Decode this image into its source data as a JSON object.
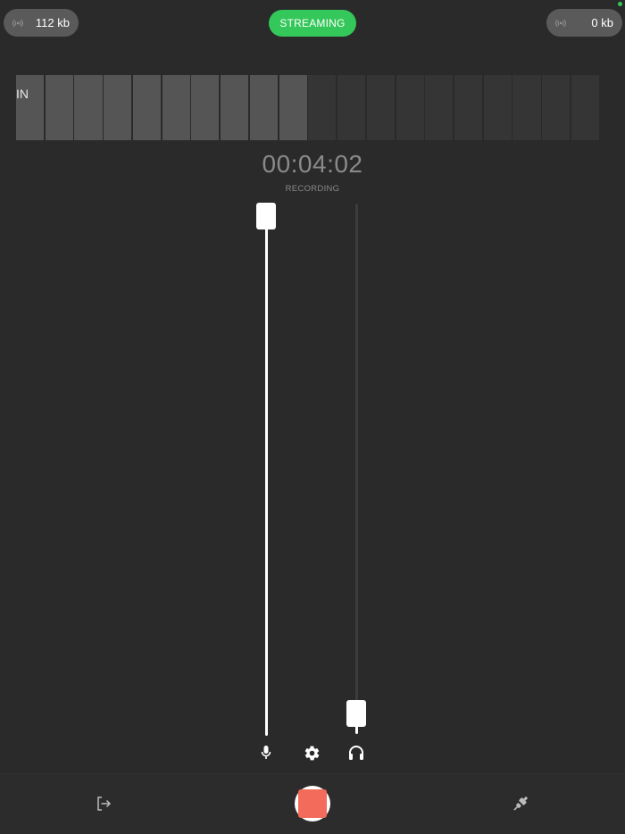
{
  "header": {
    "input_bytes": "112 kb",
    "output_bytes": "0 kb",
    "streaming_label": "STREAMING"
  },
  "meter": {
    "label": "IN",
    "segment_count": 20,
    "lit_segments": 10
  },
  "timer": {
    "elapsed": "00:04:02",
    "status": "RECORDING"
  },
  "sliders": {
    "mic_level": 1.0,
    "headphone_level": 0.04
  },
  "icons": {
    "left_pill": "broadcast-icon",
    "right_pill": "broadcast-icon",
    "mic": "microphone-icon",
    "settings": "gear-icon",
    "headphones": "headphones-icon",
    "exit": "exit-icon",
    "record": "record-stop-icon",
    "connect": "plug-icon"
  },
  "colors": {
    "accent": "#34c759",
    "record": "#f36b5b",
    "background": "#2a2a2a"
  }
}
